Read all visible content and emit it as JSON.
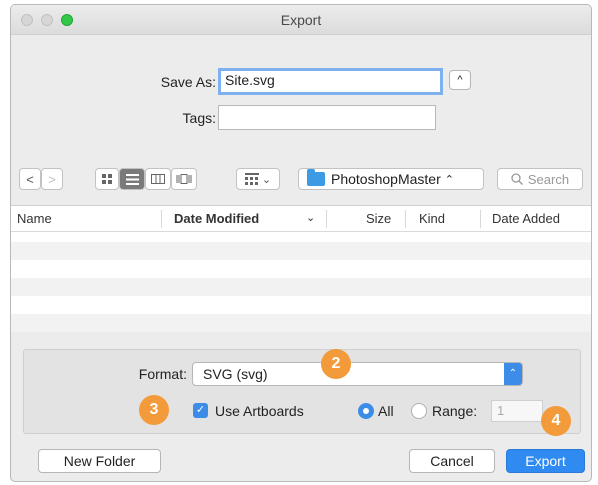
{
  "window": {
    "title": "Export"
  },
  "save": {
    "label": "Save As:",
    "value": "Site.svg",
    "expand_glyph": "^"
  },
  "tags": {
    "label": "Tags:",
    "value": ""
  },
  "toolbar": {
    "back_glyph": "<",
    "forward_glyph": ">",
    "location": "PhotoshopMaster",
    "location_arrow": "⌃",
    "search_placeholder": "Search",
    "arrange_glyph": "⌄"
  },
  "list": {
    "columns": [
      "Name",
      "Date Modified",
      "Size",
      "Kind",
      "Date Added"
    ],
    "sort_glyph": "⌄"
  },
  "format": {
    "label": "Format:",
    "value": "SVG (svg)",
    "arrow_glyph": "⌃"
  },
  "options": {
    "use_artboards_label": "Use Artboards",
    "all_label": "All",
    "range_label": "Range:",
    "range_value": "1",
    "check_glyph": "✓"
  },
  "badges": {
    "b2": "2",
    "b3": "3",
    "b4": "4"
  },
  "buttons": {
    "new_folder": "New Folder",
    "cancel": "Cancel",
    "export": "Export"
  },
  "colors": {
    "accent": "#2f8af1",
    "badge": "#f39a3a"
  }
}
